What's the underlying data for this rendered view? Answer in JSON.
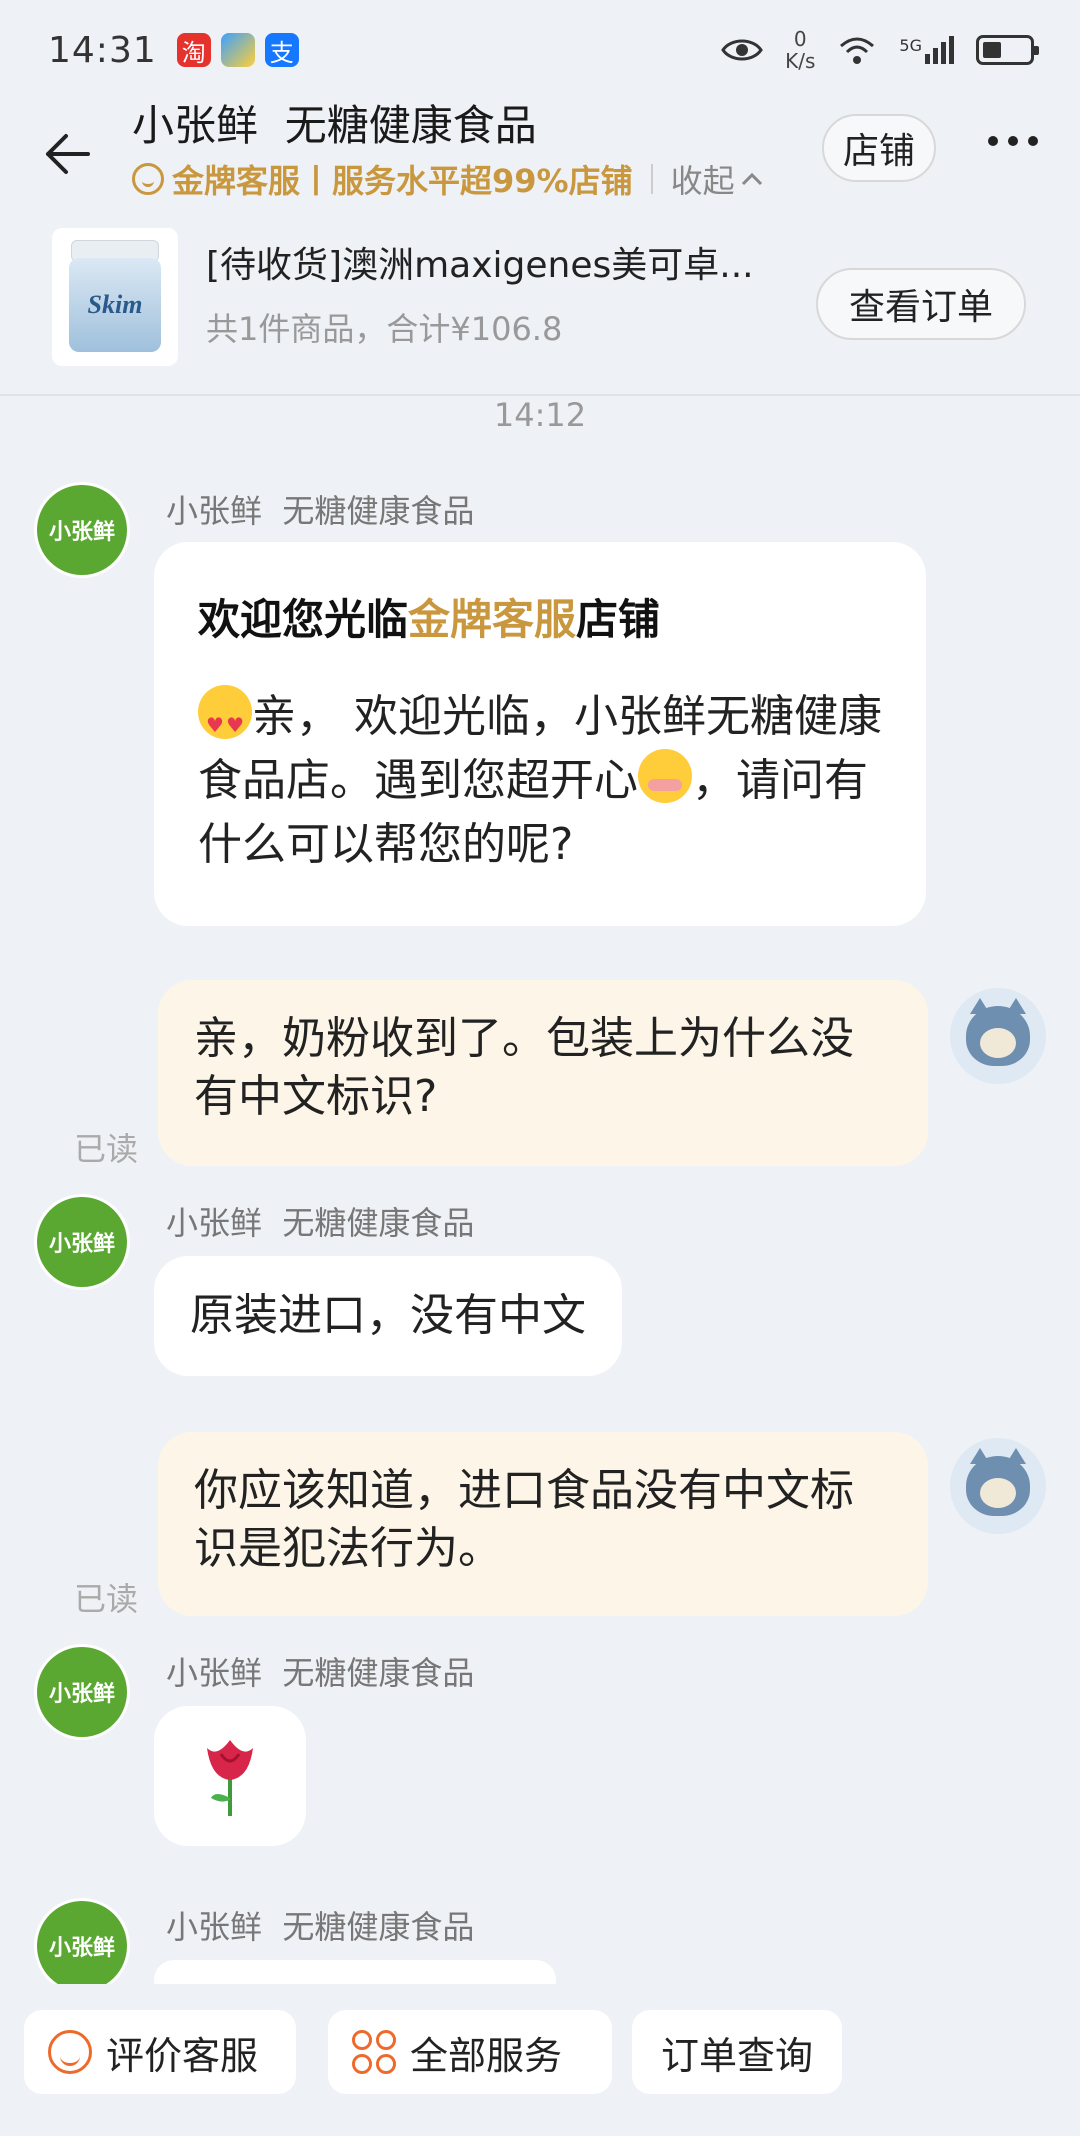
{
  "status_bar": {
    "time": "14:31",
    "app_badges": [
      "淘",
      "支"
    ],
    "net_speed_value": "0",
    "net_speed_unit": "K/s",
    "network": "5G"
  },
  "header": {
    "title": "小张鲜  无糖健康食品",
    "service_badge": "金牌客服丨服务水平超99%店铺",
    "collapse_label": "收起",
    "store_button": "店铺"
  },
  "order": {
    "product_label": "Skim",
    "title": "[待收货]澳洲maxigenes美可卓...",
    "meta": "共1件商品，合计¥106.8",
    "view_button": "查看订单"
  },
  "timestamp": "14:12",
  "messages": {
    "m1": {
      "sender": "小张鲜  无糖健康食品",
      "title_prefix": "欢迎您光临",
      "title_highlight": "金牌客服",
      "title_suffix": "店铺",
      "body_part1": "亲， 欢迎光临，小张鲜无糖健康食品店。遇到您超开心",
      "body_part2": "，请问有什么可以帮您的呢?"
    },
    "m2": {
      "text": "亲，奶粉收到了。包装上为什么没有中文标识?",
      "read": "已读"
    },
    "m3": {
      "sender": "小张鲜  无糖健康食品",
      "text": "原装进口，没有中文"
    },
    "m4": {
      "text": "你应该知道，进口食品没有中文标识是犯法行为。",
      "read": "已读"
    },
    "m5": {
      "sender": "小张鲜  无糖健康食品",
      "sticker": "rose"
    },
    "m6": {
      "sender": "小张鲜  无糖健康食品"
    }
  },
  "shop_avatar_text": "小张鲜",
  "bottom_bar": {
    "rate_service": "评价客服",
    "all_services": "全部服务",
    "order_query": "订单查询"
  },
  "colors": {
    "gold": "#c9973e",
    "accent_orange": "#ee6a2b",
    "user_bubble": "#fdf6e8",
    "shop_green": "#5aa832"
  }
}
